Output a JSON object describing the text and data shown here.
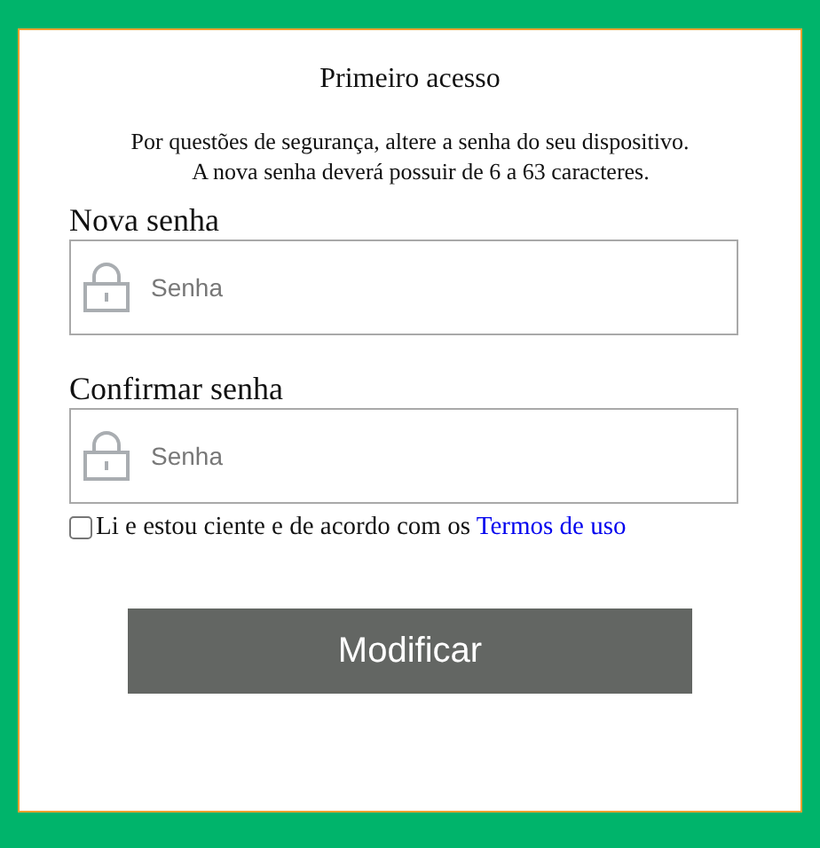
{
  "title": "Primeiro acesso",
  "info": [
    "Por questões de segurança, altere a senha do seu dispositivo.",
    "A nova senha deverá possuir de 6 a 63 caracteres."
  ],
  "fields": [
    {
      "label": "Nova senha",
      "placeholder": "Senha"
    },
    {
      "label": "Confirmar senha",
      "placeholder": "Senha"
    }
  ],
  "agreement": {
    "checked": false,
    "text": "Li e estou ciente e de acordo com os",
    "link": "Termos de uso"
  },
  "button": "Modificar"
}
